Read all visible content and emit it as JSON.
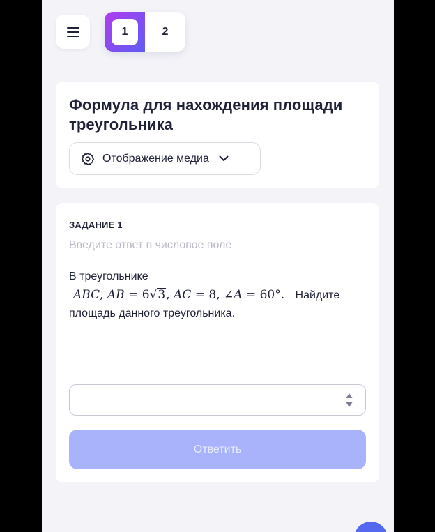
{
  "header": {
    "menu_icon": "hamburger-icon",
    "tabs": [
      {
        "label": "1",
        "active": true
      },
      {
        "label": "2",
        "active": false
      }
    ]
  },
  "lesson": {
    "title": "Формула для нахождения площади треугольника",
    "media_button": {
      "label": "Отображение медиа",
      "icon": "gear-icon",
      "chevron": "chevron-down-icon"
    }
  },
  "task": {
    "heading": "ЗАДАНИЕ 1",
    "hint": "Введите ответ в числовое поле",
    "text_before": "В треугольнике",
    "math": "ABC, AB = 6√3, AC = 8, ∠A = 60°.",
    "text_after": "Найдите площадь данного треугольника.",
    "answer_value": "",
    "submit_label": "Ответить"
  },
  "colors": {
    "accent_gradient_start": "#b03cf0",
    "accent_gradient_end": "#5e5cf2",
    "submit_disabled": "#a8b3fb",
    "fab": "#5468f0",
    "background": "#f3f3f8"
  }
}
